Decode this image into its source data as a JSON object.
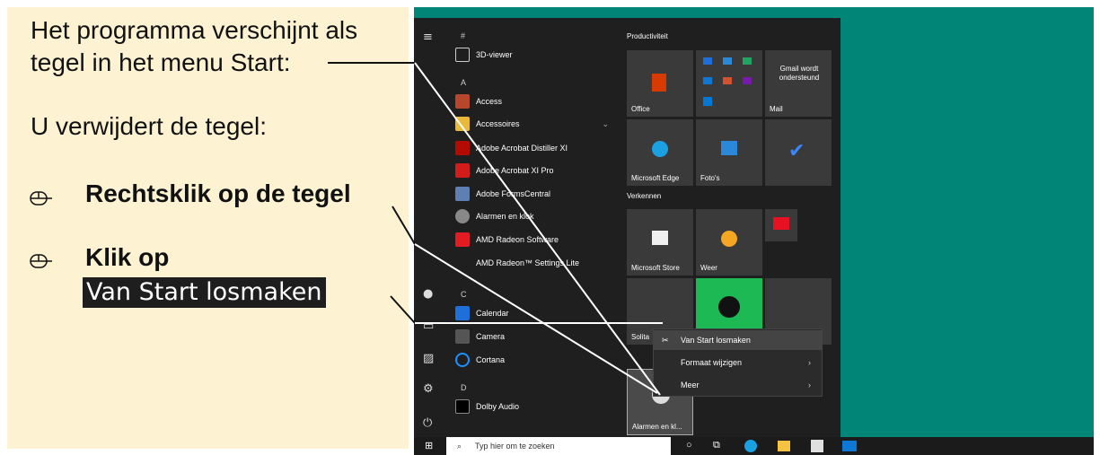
{
  "instructions": {
    "line1": "Het programma verschijnt als",
    "line2": "tegel in het menu Start:",
    "line3": "U verwijdert de tegel:",
    "step1": "Rechtsklik op de tegel",
    "step2": "Klik op",
    "step2_button": "Van Start losmaken"
  },
  "start_menu": {
    "hash": "#",
    "apps": [
      {
        "label": "3D-viewer",
        "color": "#444"
      },
      {
        "label": "A",
        "color": ""
      },
      {
        "label": "Access",
        "color": "#b7472a"
      },
      {
        "label": "Accessoires",
        "color": "#e8b93b"
      },
      {
        "label": "Adobe Acrobat Distiller XI",
        "color": "#b30b00"
      },
      {
        "label": "Adobe Acrobat XI Pro",
        "color": "#d21b1b"
      },
      {
        "label": "Adobe FormsCentral",
        "color": "#5f7fb3"
      },
      {
        "label": "Alarmen en klok",
        "color": "#888"
      },
      {
        "label": "AMD Radeon Software",
        "color": "#e31b23"
      },
      {
        "label": "AMD Radeon™ Settings Lite",
        "color": ""
      },
      {
        "label": "C",
        "color": ""
      },
      {
        "label": "Calendar",
        "color": "#1e6fd9"
      },
      {
        "label": "Camera",
        "color": "#555"
      },
      {
        "label": "Cortana",
        "color": "#1e90ff"
      },
      {
        "label": "D",
        "color": ""
      },
      {
        "label": "Dolby Audio",
        "color": "#000"
      }
    ],
    "groups": {
      "productivity": "Productiviteit",
      "explore": "Verkennen"
    },
    "tiles": {
      "office": "Office",
      "mail_note": "Gmail wordt ondersteund",
      "mail": "Mail",
      "edge": "Microsoft Edge",
      "photos": "Foto's",
      "store": "Microsoft Store",
      "weather": "Weer",
      "solitaire": "Solita",
      "alarms": "Alarmen en kl..."
    },
    "context_menu": [
      "Van Start losmaken",
      "Formaat wijzigen",
      "Meer"
    ]
  },
  "taskbar": {
    "search_placeholder": "Typ hier om te zoeken"
  }
}
